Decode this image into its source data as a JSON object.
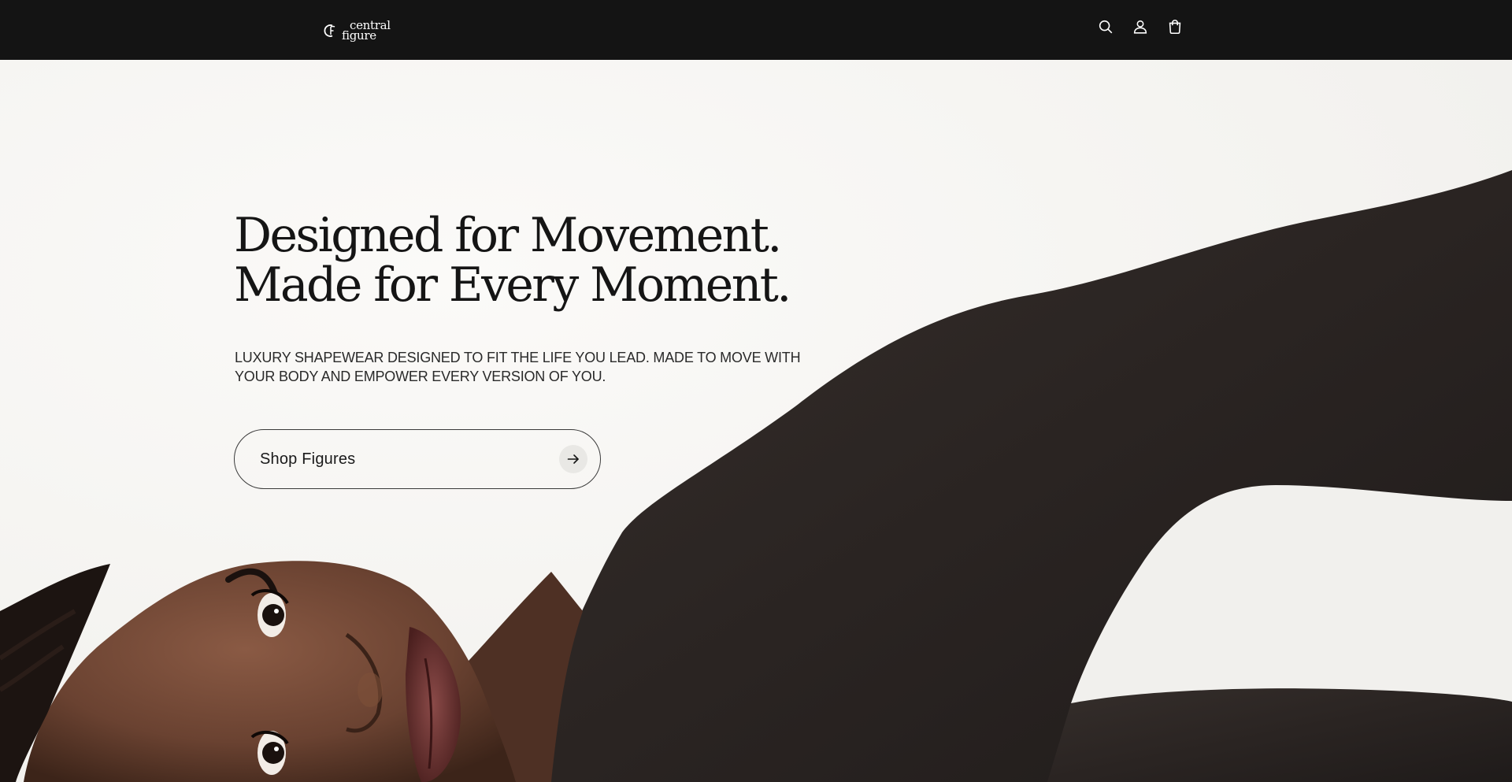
{
  "header": {
    "logo": {
      "line1": "central",
      "line2": "figure",
      "mark": "cf-monogram"
    },
    "icons": [
      {
        "name": "search-icon",
        "label": "Search"
      },
      {
        "name": "account-icon",
        "label": "Account"
      },
      {
        "name": "cart-icon",
        "label": "Cart"
      }
    ]
  },
  "hero": {
    "title_line1": "Designed for Movement.",
    "title_line2": "Made for Every Moment.",
    "subtitle": "LUXURY SHAPEWEAR DESIGNED TO FIT THE LIFE YOU LEAD. MADE TO MOVE WITH YOUR BODY AND EMPOWER EVERY VERSION OF YOU.",
    "cta_label": "Shop Figures",
    "cta_icon": "arrow-right-icon",
    "image": "model-in-black-bodysuit-lying-down"
  },
  "colors": {
    "header_bg": "#141414",
    "hero_bg": "#f6f5f2",
    "text": "#151515",
    "garment": "#2b2624",
    "skin": "#6b4331"
  }
}
